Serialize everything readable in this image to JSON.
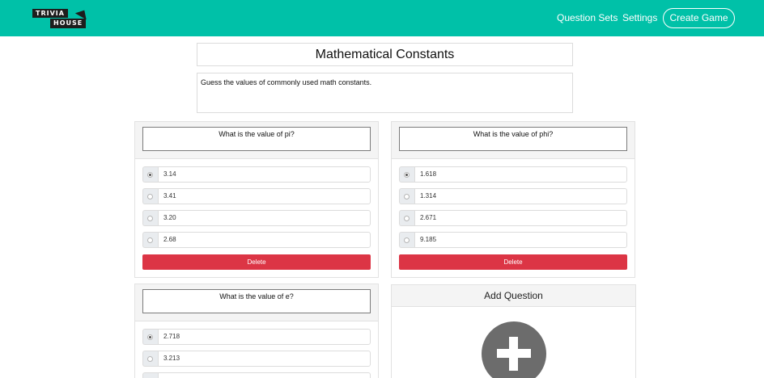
{
  "navbar": {
    "logo_top": "TRIVIA",
    "logo_bottom": "HOUSE",
    "links": [
      "Question Sets",
      "Settings"
    ],
    "create_button": "Create Game",
    "bg_color": "#00c1a8"
  },
  "set": {
    "title": "Mathematical Constants",
    "description": "Guess the values of commonly used math constants."
  },
  "questions": [
    {
      "text": "What is the value of pi?",
      "options": [
        "3.14",
        "3.41",
        "3.20",
        "2.68"
      ],
      "selected": 0,
      "delete_label": "Delete"
    },
    {
      "text": "What is the value of phi?",
      "options": [
        "1.618",
        "1.314",
        "2.671",
        "9.185"
      ],
      "selected": 0,
      "delete_label": "Delete"
    },
    {
      "text": "What is the value of e?",
      "options": [
        "2.718",
        "3.213",
        ""
      ],
      "selected": 0,
      "delete_label": ""
    }
  ],
  "add_question": {
    "label": "Add Question",
    "icon": "plus-icon"
  },
  "colors": {
    "delete": "#dc3545",
    "plus_circle": "#6c6c6c"
  }
}
